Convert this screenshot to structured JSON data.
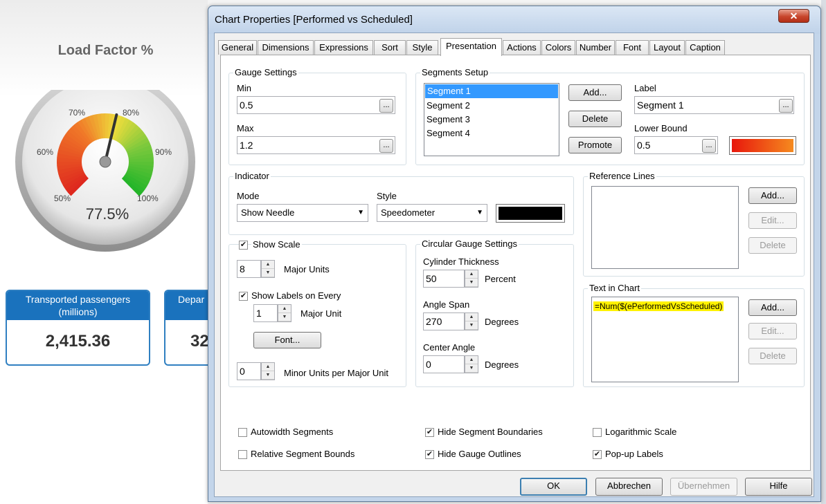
{
  "dashboard": {
    "gauge_title": "Load Factor %",
    "gauge_value": "77.5%",
    "gauge_value_fraction": 0.775,
    "gauge_labels": [
      "50%",
      "60%",
      "70%",
      "80%",
      "90%",
      "100%"
    ],
    "kpi1": {
      "title_line1": "Transported passengers",
      "title_line2": "(millions)",
      "value": "2,415.36"
    },
    "kpi2": {
      "title_line1": "Depar",
      "title_line2": "(",
      "value": "32"
    }
  },
  "dialog": {
    "title": "Chart Properties [Performed vs Scheduled]",
    "close_label": "✕",
    "tabs": [
      "General",
      "Dimensions",
      "Expressions",
      "Sort",
      "Style",
      "Presentation",
      "Actions",
      "Colors",
      "Number",
      "Font",
      "Layout",
      "Caption"
    ],
    "active_tab": "Presentation",
    "gauge_settings": {
      "group_label": "Gauge Settings",
      "min_label": "Min",
      "min_value": "0.5",
      "max_label": "Max",
      "max_value": "1.2",
      "ellipsis": "..."
    },
    "segments_setup": {
      "group_label": "Segments Setup",
      "segments": [
        "Segment 1",
        "Segment 2",
        "Segment 3",
        "Segment 4"
      ],
      "add_label": "Add...",
      "delete_label": "Delete",
      "promote_label": "Promote",
      "label_label": "Label",
      "label_value": "Segment 1",
      "lower_bound_label": "Lower Bound",
      "lower_bound_value": "0.5",
      "segment_color_from": "#e8170c",
      "segment_color_to": "#f58a1f"
    },
    "indicator": {
      "group_label": "Indicator",
      "mode_label": "Mode",
      "mode_value": "Show Needle",
      "style_label": "Style",
      "style_value": "Speedometer",
      "color": "#000000"
    },
    "reference_lines": {
      "group_label": "Reference Lines",
      "add_label": "Add...",
      "edit_label": "Edit...",
      "delete_label": "Delete"
    },
    "show_scale": {
      "label": "Show Scale",
      "checked": true,
      "major_units_value": "8",
      "major_units_label": "Major Units",
      "show_labels_label": "Show Labels on Every",
      "show_labels_checked": true,
      "major_unit_value": "1",
      "major_unit_label": "Major Unit",
      "font_label": "Font...",
      "minor_units_value": "0",
      "minor_units_label": "Minor Units per Major Unit"
    },
    "circular_gauge": {
      "group_label": "Circular Gauge Settings",
      "cylinder_label": "Cylinder Thickness",
      "cylinder_value": "50",
      "cylinder_unit": "Percent",
      "angle_span_label": "Angle Span",
      "angle_span_value": "270",
      "angle_span_unit": "Degrees",
      "center_angle_label": "Center Angle",
      "center_angle_value": "0",
      "center_angle_unit": "Degrees"
    },
    "text_in_chart": {
      "group_label": "Text in Chart",
      "expression": "=Num($(ePerformedVsScheduled)",
      "add_label": "Add...",
      "edit_label": "Edit...",
      "delete_label": "Delete"
    },
    "checkboxes": {
      "autowidth": {
        "label": "Autowidth Segments",
        "checked": false
      },
      "relative_bounds": {
        "label": "Relative Segment Bounds",
        "checked": false
      },
      "hide_boundaries": {
        "label": "Hide Segment Boundaries",
        "checked": true
      },
      "hide_outlines": {
        "label": "Hide Gauge Outlines",
        "checked": true
      },
      "log_scale": {
        "label": "Logarithmic Scale",
        "checked": false
      },
      "popup_labels": {
        "label": "Pop-up Labels",
        "checked": true
      }
    },
    "footer": {
      "ok": "OK",
      "cancel": "Abbrechen",
      "apply": "Übernehmen",
      "help": "Hilfe"
    }
  }
}
